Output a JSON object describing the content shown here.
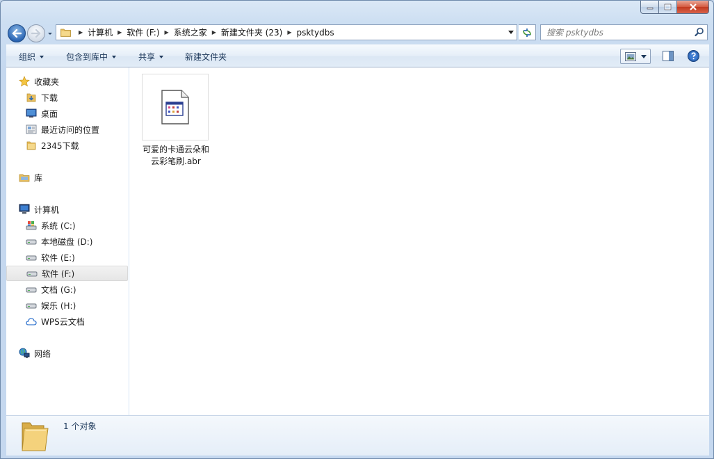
{
  "address": {
    "crumbs": [
      "计算机",
      "软件 (F:)",
      "系统之家",
      "新建文件夹 (23)",
      "psktydbs"
    ]
  },
  "search": {
    "placeholder": "搜索 psktydbs"
  },
  "toolbar": {
    "organize": "组织",
    "include_in_library": "包含到库中",
    "share": "共享",
    "new_folder": "新建文件夹"
  },
  "sidebar": {
    "favorites": {
      "label": "收藏夹",
      "items": [
        {
          "label": "下载",
          "icon": "download-folder-icon"
        },
        {
          "label": "桌面",
          "icon": "desktop-icon"
        },
        {
          "label": "最近访问的位置",
          "icon": "recent-places-icon"
        },
        {
          "label": "2345下载",
          "icon": "folder-icon"
        }
      ]
    },
    "libraries": {
      "label": "库"
    },
    "computer": {
      "label": "计算机",
      "items": [
        {
          "label": "系统 (C:)",
          "icon": "system-drive-icon"
        },
        {
          "label": "本地磁盘 (D:)",
          "icon": "drive-icon"
        },
        {
          "label": "软件 (E:)",
          "icon": "drive-icon"
        },
        {
          "label": "软件 (F:)",
          "icon": "drive-icon",
          "selected": true
        },
        {
          "label": "文档 (G:)",
          "icon": "drive-icon"
        },
        {
          "label": "娱乐 (H:)",
          "icon": "drive-icon"
        },
        {
          "label": "WPS云文档",
          "icon": "cloud-icon"
        }
      ]
    },
    "network": {
      "label": "网络"
    }
  },
  "files": [
    {
      "name": "可爱的卡通云朵和云彩笔刷.abr",
      "icon": "abr-file-icon"
    }
  ],
  "status": {
    "text": "1 个对象"
  },
  "colors": {
    "frame": "#c5d8ef",
    "toolbar_text": "#1e395b",
    "selection": "#e8e8e8"
  }
}
